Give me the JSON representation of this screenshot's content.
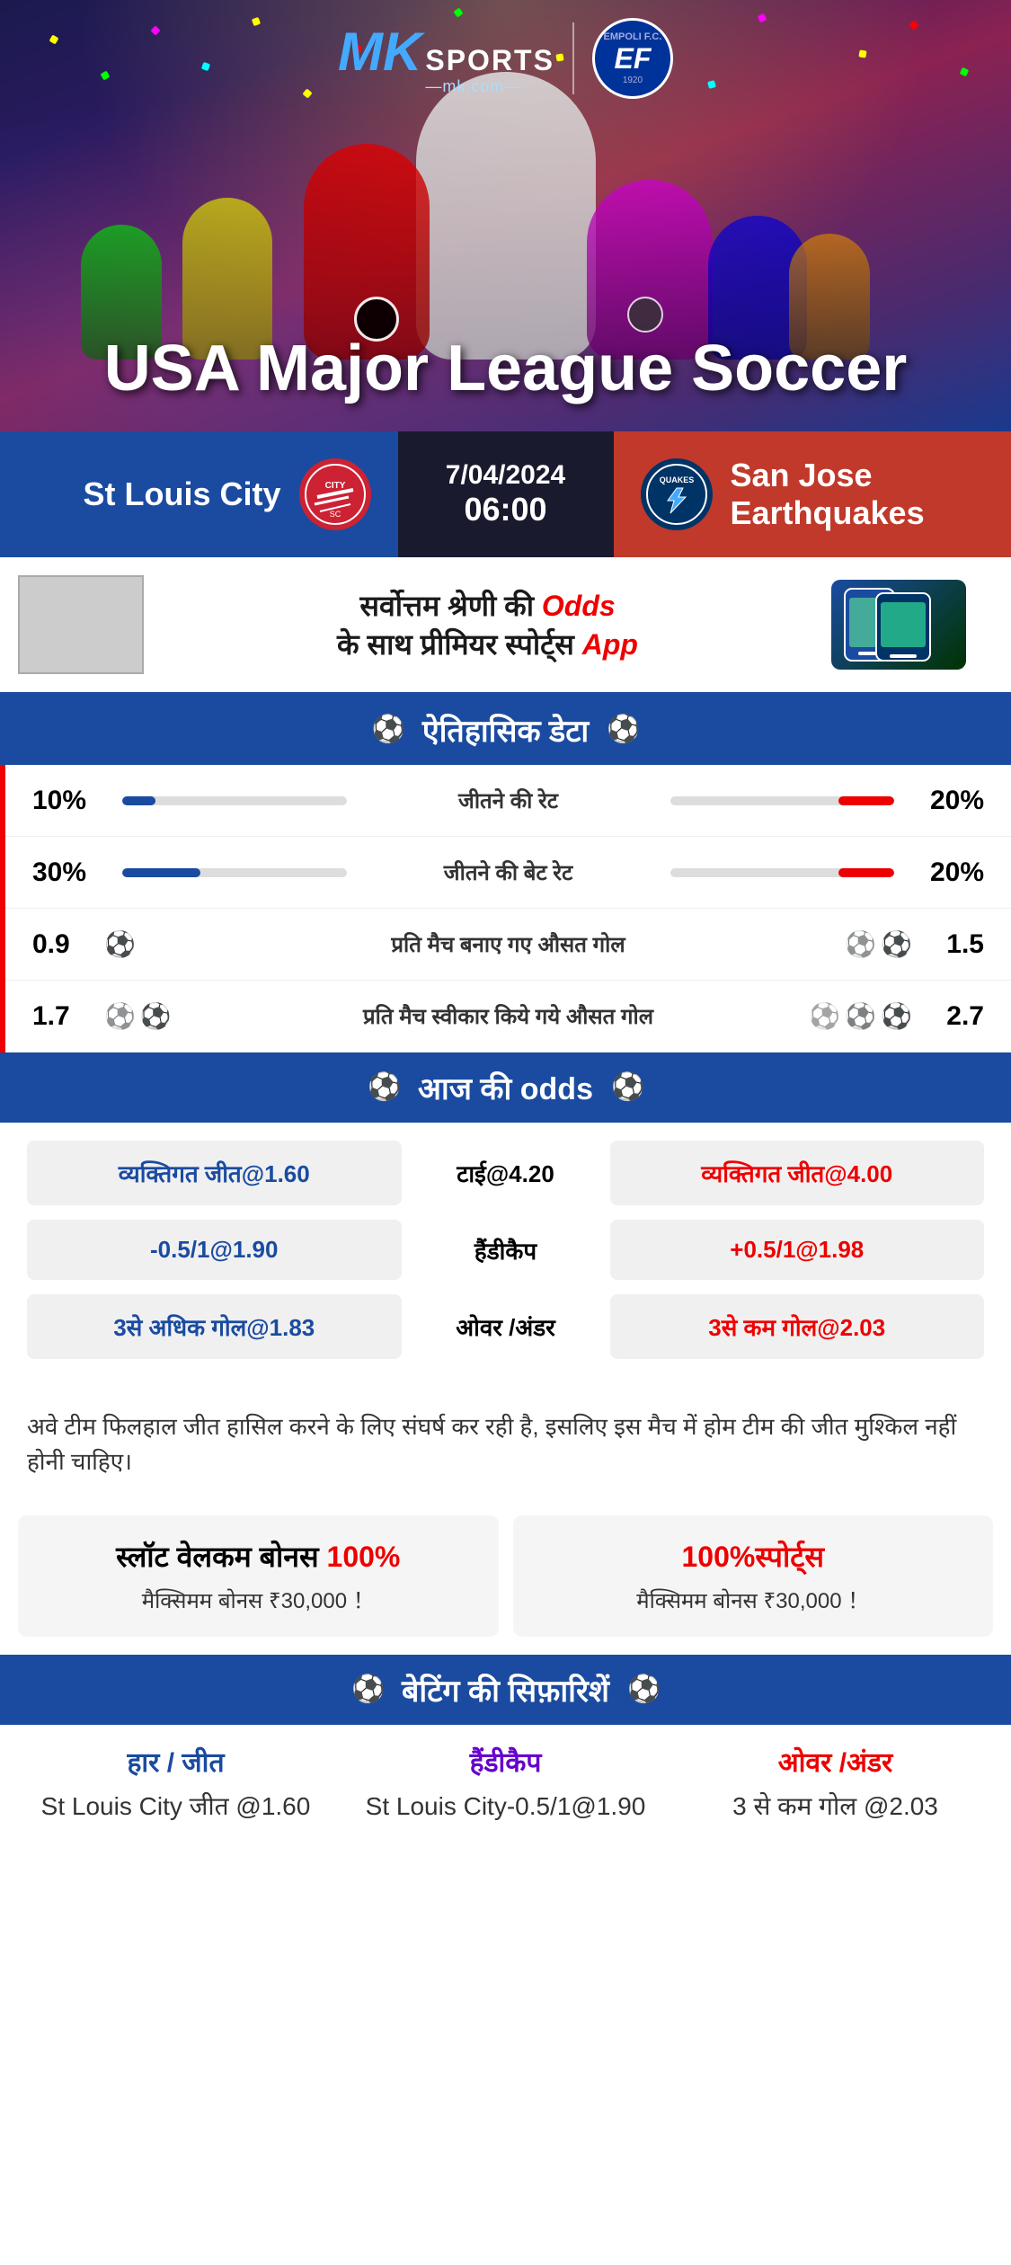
{
  "header": {
    "brand": "MK",
    "brand_sports": "SPORTS",
    "brand_url": "mk.com",
    "partner": "EMPOLI F.C.",
    "partner_year": "1920",
    "league_title": "USA Major League Soccer"
  },
  "match": {
    "team_home": "St Louis City",
    "team_away": "San Jose Earthquakes",
    "team_away_abbr": "QUAKES",
    "date": "7/04/2024",
    "time": "06:00"
  },
  "promo": {
    "text_part1": "सर्वोत्तम श्रेणी की",
    "text_highlight": "Odds",
    "text_part2": "के साथ प्रीमियर स्पोर्ट्स",
    "text_highlight2": "App"
  },
  "historical_section": {
    "title": "ऐतिहासिक डेटा",
    "stats": [
      {
        "label": "जीतने की रेट",
        "left_val": "10%",
        "right_val": "20%",
        "left_pct": 15,
        "right_pct": 25
      },
      {
        "label": "जीतने की बेट रेट",
        "left_val": "30%",
        "right_val": "20%",
        "left_pct": 35,
        "right_pct": 25
      },
      {
        "label": "प्रति मैच बनाए गए औसत गोल",
        "left_val": "0.9",
        "right_val": "1.5",
        "left_balls": 1,
        "right_balls": 2
      },
      {
        "label": "प्रति मैच स्वीकार किये गये औसत गोल",
        "left_val": "1.7",
        "right_val": "2.7",
        "left_balls": 2,
        "right_balls": 3
      }
    ]
  },
  "odds_section": {
    "title": "आज की odds",
    "rows": [
      {
        "left_label": "व्यक्तिगत जीत@1.60",
        "center_label": "टाई@4.20",
        "right_label": "व्यक्तिगत जीत@4.00",
        "left_color": "blue",
        "right_color": "red"
      },
      {
        "left_label": "-0.5/1@1.90",
        "center_label": "हैंडीकैप",
        "right_label": "+0.5/1@1.98",
        "left_color": "blue",
        "right_color": "red"
      },
      {
        "left_label": "3से अधिक गोल@1.83",
        "center_label": "ओवर /अंडर",
        "right_label": "3से कम गोल@2.03",
        "left_color": "blue",
        "right_color": "red"
      }
    ]
  },
  "info_text": "अवे टीम फिलहाल जीत हासिल करने के लिए संघर्ष कर रही है, इसलिए इस मैच में होम टीम की जीत मुश्किल नहीं होनी चाहिए।",
  "bonus": {
    "left": {
      "title_main": "स्लॉट वेलकम बोनस",
      "percent": "100%",
      "sub": "मैक्सिमम बोनस ₹30,000 ！"
    },
    "right": {
      "percent": "100%",
      "title_main": "स्पोर्ट्स",
      "sub": "मैक्सिमम बोनस  ₹30,000 ！"
    }
  },
  "betting_section": {
    "title": "बेटिंग की सिफ़ारिशें",
    "recommendations": [
      {
        "type": "हार / जीत",
        "type_color": "blue",
        "value": "St Louis City जीत @1.60"
      },
      {
        "type": "हैंडीकैप",
        "type_color": "purple",
        "value": "St Louis City-0.5/1@1.90"
      },
      {
        "type": "ओवर /अंडर",
        "type_color": "red",
        "value": "3 से कम गोल @2.03"
      }
    ]
  }
}
